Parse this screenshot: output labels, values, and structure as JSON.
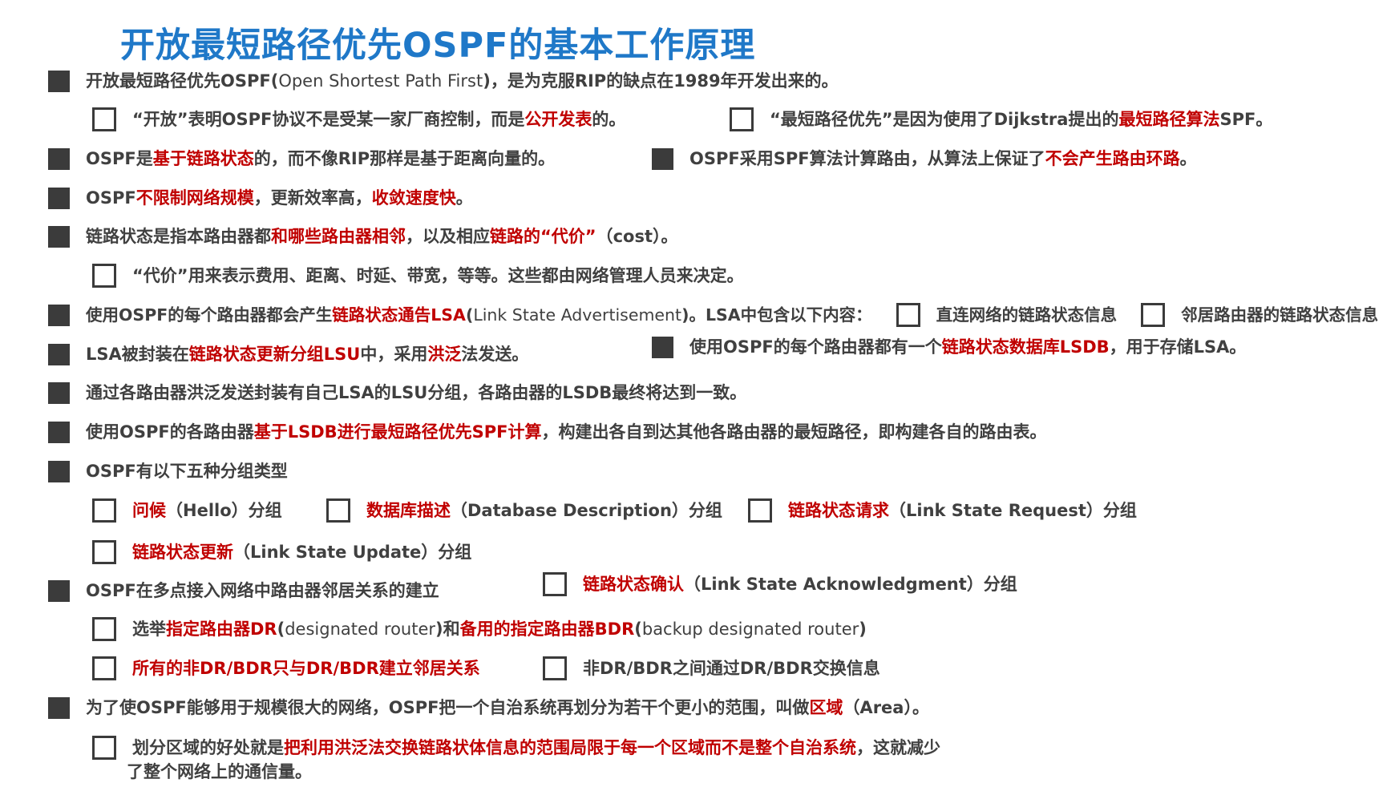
{
  "title": "开放最短路径优先OSPF的基本工作原理",
  "r1": {
    "a": "开放最短路径优先OSPF(",
    "b": "Open Shortest Path First",
    "c": ")，是为克服RIP的缺点在1989年开发出来的。"
  },
  "r2a": {
    "a": "“开放”表明OSPF协议不是受某一家厂商控制，而是",
    "b": "公开发表",
    "c": "的。"
  },
  "r2b": {
    "a": "“最短路径优先”是因为使用了Dijkstra提出的",
    "b": "最短路径算法",
    "c": "SPF。"
  },
  "r3a": {
    "a": "OSPF是",
    "b": "基于链路状态",
    "c": "的，而不像RIP那样是基于距离向量的。"
  },
  "r3b": {
    "a": "OSPF采用SPF算法计算路由，从算法上保证了",
    "b": "不会产生路由环路",
    "c": "。"
  },
  "r4": {
    "a": "OSPF",
    "b": "不限制网络规模",
    "c": "，更新效率高，",
    "d": "收敛速度快",
    "e": "。"
  },
  "r5": {
    "a": "链路状态是指本路由器都",
    "b": "和哪些路由器相邻",
    "c": "，以及相应",
    "d": "链路的“代价”",
    "e": "（cost）。"
  },
  "r6": {
    "a": "“代价”用来表示费用、距离、时延、带宽，等等。这些都由网络管理人员来决定。"
  },
  "r7": {
    "a": "使用OSPF的每个路由器都会产生",
    "b": "链路状态通告LSA",
    "c": "(",
    "d": "Link State Advertisement",
    "e": ")。LSA中包含以下内容：",
    "opt1": "直连网络的链路状态信息",
    "opt2": "邻居路由器的链路状态信息"
  },
  "r8a": {
    "a": "LSA被封装在",
    "b": "链路状态更新分组LSU",
    "c": "中，采用",
    "d": "洪泛",
    "e": "法发送。"
  },
  "r8b": {
    "a": "使用OSPF的每个路由器都有一个",
    "b": "链路状态数据库LSDB",
    "c": "，用于存储LSA。"
  },
  "r9": {
    "a": "通过各路由器洪泛发送封装有自己LSA的LSU分组，各路由器的LSDB最终将达到一致。"
  },
  "r10": {
    "a": "使用OSPF的各路由器",
    "b": "基于LSDB进行最短路径优先SPF计算",
    "c": "，构建出各自到达其他各路由器的最短路径，即构建各自的路由表。"
  },
  "r11": {
    "a": "OSPF有以下五种分组类型"
  },
  "pk1": {
    "a": "问候",
    "b": "（Hello）分组"
  },
  "pk2": {
    "a": "数据库描述",
    "b": "（Database Description）分组"
  },
  "pk3": {
    "a": "链路状态请求",
    "b": "（Link State Request）分组"
  },
  "pk4": {
    "a": "链路状态更新",
    "b": "（Link State Update）分组"
  },
  "r13": {
    "a": "OSPF在多点接入网络中路由器邻居关系的建立"
  },
  "pk5": {
    "a": "链路状态确认",
    "b": "（Link State Acknowledgment）分组"
  },
  "r14": {
    "a": "选举",
    "b": "指定路由器DR",
    "c": "(",
    "d": "designated router",
    "e": ")和",
    "f": "备用的指定路由器BDR",
    "g": "(",
    "h": "backup designated router",
    "i": ")"
  },
  "r15a": {
    "a": "所有的非DR/BDR只与DR/BDR建立邻居关系"
  },
  "r15b": {
    "a": "非DR/BDR之间通过DR/BDR交换信息"
  },
  "r16": {
    "a": "为了使OSPF能够用于规模很大的网络，OSPF把一个自治系统再划分为若干个更小的范围，叫做",
    "b": "区域",
    "c": "（Area）。"
  },
  "r17": {
    "a": "划分区域的好处就是",
    "b": "把利用洪泛法交换链路状体信息的范围局限于每一个区域而不是整个自治系统",
    "c": "，这就减少",
    "d": "了整个网络上的通信量。"
  }
}
